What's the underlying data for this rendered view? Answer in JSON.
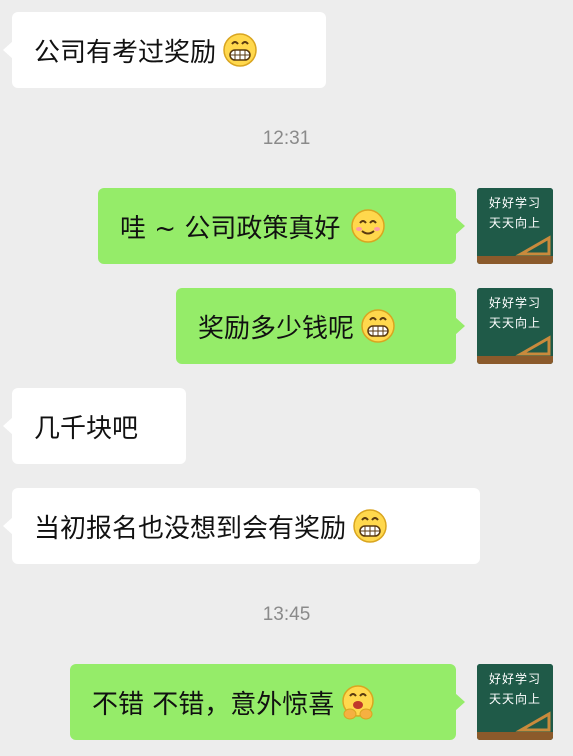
{
  "messages": [
    {
      "side": "in",
      "text": "公司有考过奖励",
      "emoji": "grinning-face"
    },
    {
      "side": "time",
      "text": "12:31"
    },
    {
      "side": "out",
      "text": "哇 ~ 公司政策真好",
      "emoji": "smiling-face"
    },
    {
      "side": "out",
      "text": "奖励多少钱呢",
      "emoji": "grinning-face"
    },
    {
      "side": "in",
      "text": "几千块吧"
    },
    {
      "side": "in",
      "text": "当初报名也没想到会有奖励",
      "emoji": "grinning-face"
    },
    {
      "side": "time",
      "text": "13:45"
    },
    {
      "side": "out",
      "text": "不错 不错，意外惊喜",
      "emoji": "cheering-face"
    }
  ],
  "avatar": {
    "line1": "好好学习",
    "line2": "天天向上",
    "icon": "chalkboard-avatar"
  },
  "colors": {
    "background": "#ededed",
    "incoming_bubble": "#ffffff",
    "outgoing_bubble": "#95ec69",
    "timestamp": "#8a8a8a"
  }
}
